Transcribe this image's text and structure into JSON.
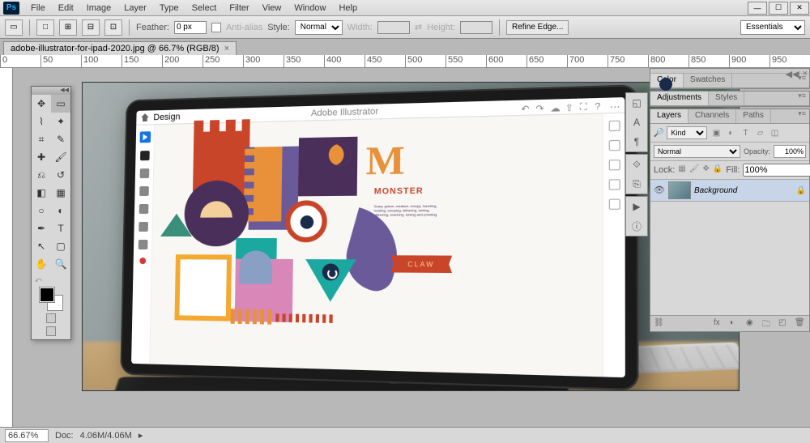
{
  "app": {
    "logo": "Ps"
  },
  "menu": [
    "File",
    "Edit",
    "Image",
    "Layer",
    "Type",
    "Select",
    "Filter",
    "View",
    "Window",
    "Help"
  ],
  "options": {
    "feather_label": "Feather:",
    "feather_value": "0 px",
    "antialias_label": "Anti-alias",
    "style_label": "Style:",
    "style_value": "Normal",
    "width_label": "Width:",
    "height_label": "Height:",
    "refine_label": "Refine Edge...",
    "workspace": "Essentials"
  },
  "document": {
    "tab_title": "adobe-illustrator-for-ipad-2020.jpg @ 66.7% (RGB/8)"
  },
  "status": {
    "zoom": "66.67%",
    "doc_label": "Doc:",
    "doc_value": "4.06M/4.06M"
  },
  "panels": {
    "color_tabs": [
      "Color",
      "Swatches"
    ],
    "adjust_tabs": [
      "Adjustments",
      "Styles"
    ],
    "layer_tabs": [
      "Layers",
      "Channels",
      "Paths"
    ],
    "layers": {
      "kind": "Kind",
      "blend": "Normal",
      "opacity_label": "Opacity:",
      "opacity": "100%",
      "lock_label": "Lock:",
      "fill_label": "Fill:",
      "fill": "100%",
      "bg_layer": "Background"
    }
  },
  "ipad": {
    "doc_label": "Design",
    "app_title": "Adobe Illustrator",
    "letter": "M",
    "word": "MONSTER",
    "claw": "CLAW",
    "lorem": "Scary, golem, creature, creepy, haunting, howling, creeping, slithering, lurking, gibbering, clutching, lurking and prowling."
  }
}
